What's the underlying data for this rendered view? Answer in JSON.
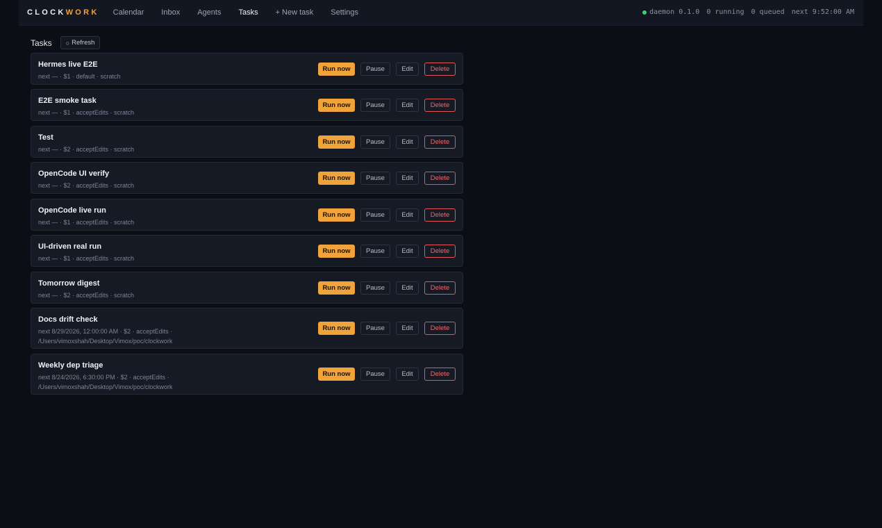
{
  "app": {
    "brand_part1": "CLOCK",
    "brand_part2": "WORK",
    "accent_color": "#f0a33a"
  },
  "nav": [
    {
      "label": "Calendar",
      "active": false
    },
    {
      "label": "Inbox",
      "active": false
    },
    {
      "label": "Agents",
      "active": false
    },
    {
      "label": "Tasks",
      "active": true
    },
    {
      "label": "+ New task",
      "active": false
    },
    {
      "label": "Settings",
      "active": false
    }
  ],
  "status": {
    "daemon": "daemon 0.1.0",
    "running": "0 running",
    "queued": "0 queued",
    "next": "next 9:52:00 AM",
    "indicator_color": "#3ecf7a"
  },
  "page": {
    "title": "Tasks",
    "refresh_icon": "refresh-icon",
    "refresh_glyph": "○",
    "refresh_label": "Refresh"
  },
  "buttons": {
    "run": "Run now",
    "pause": "Pause",
    "edit": "Edit",
    "delete": "Delete"
  },
  "tasks": [
    {
      "name": "Hermes live E2E",
      "meta": "next — · $1 · default · scratch"
    },
    {
      "name": "E2E smoke task",
      "meta": "next — · $1 · acceptEdits · scratch"
    },
    {
      "name": "Test",
      "meta": "next — · $2 · acceptEdits · scratch"
    },
    {
      "name": "OpenCode UI verify",
      "meta": "next — · $2 · acceptEdits · scratch"
    },
    {
      "name": "OpenCode live run",
      "meta": "next — · $1 · acceptEdits · scratch"
    },
    {
      "name": "UI-driven real run",
      "meta": "next — · $1 · acceptEdits · scratch"
    },
    {
      "name": "Tomorrow digest",
      "meta": "next — · $2 · acceptEdits · scratch"
    },
    {
      "name": "Docs drift check",
      "meta": "next 8/29/2026, 12:00:00 AM · $2 · acceptEdits · /Users/vimoxshah/Desktop/Vimox/poc/clockwork"
    },
    {
      "name": "Weekly dep triage",
      "meta": "next 8/24/2026, 6:30:00 PM · $2 · acceptEdits · /Users/vimoxshah/Desktop/Vimox/poc/clockwork"
    }
  ]
}
